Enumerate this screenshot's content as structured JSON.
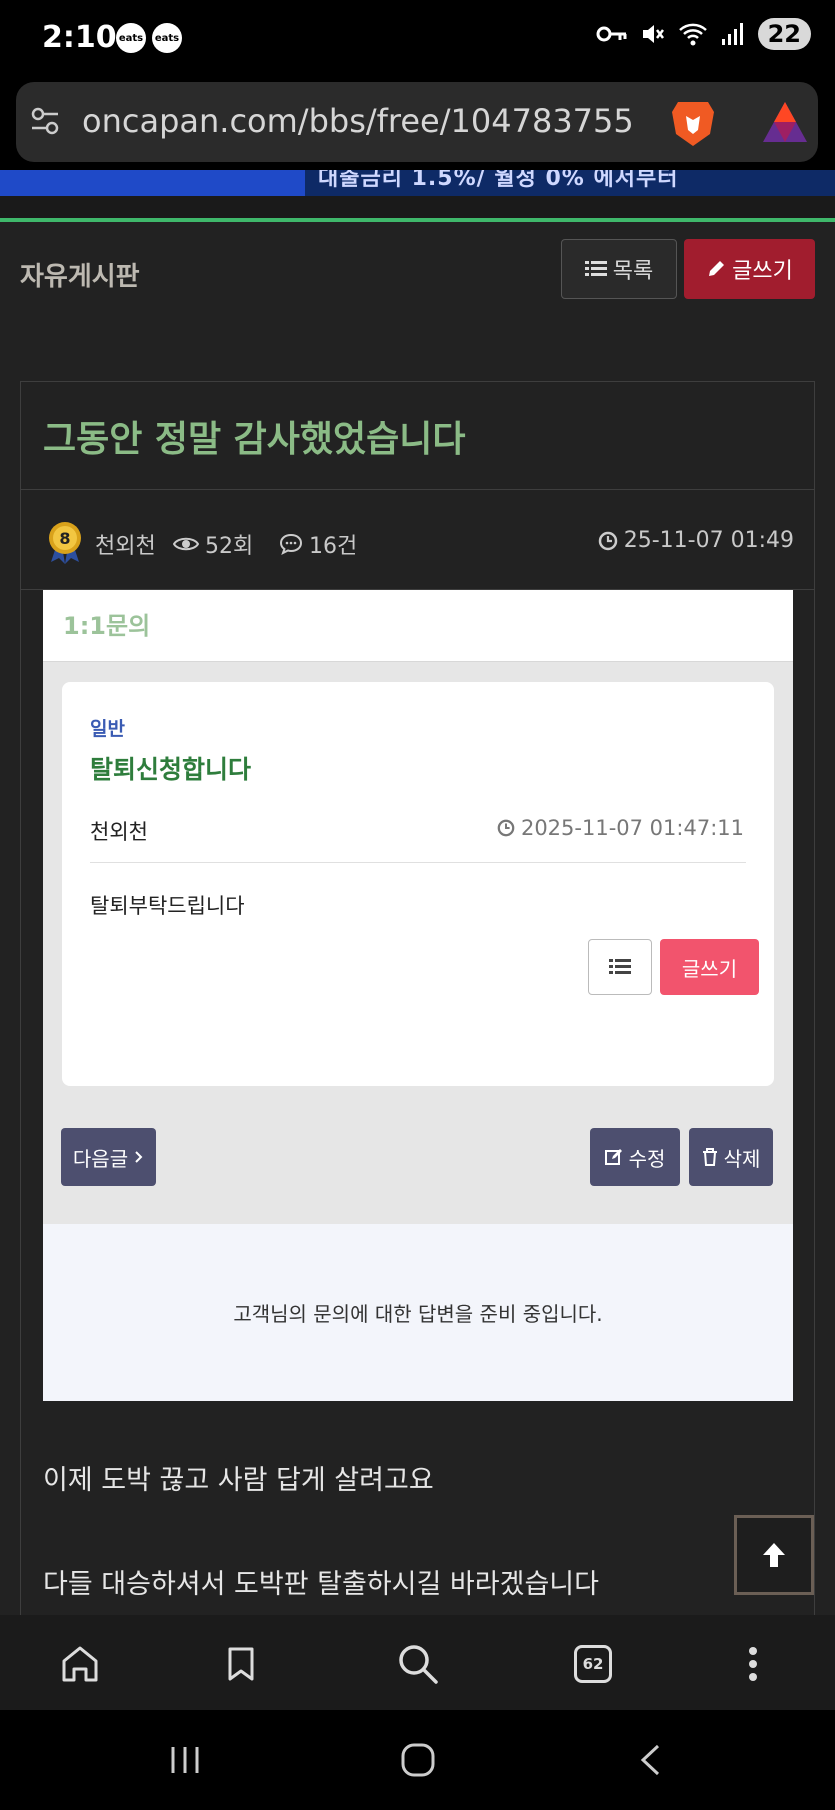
{
  "status": {
    "time": "2:10",
    "notif1": "eats",
    "notif2": "eats",
    "battery": "22"
  },
  "browser": {
    "url": "oncapan.com/bbs/free/104783755",
    "tab_count": "62"
  },
  "banner": {
    "text": "대출금리 1.5%/ 월정 0% 에서부터"
  },
  "board": {
    "title": "자유게시판",
    "list_label": "목록",
    "write_label": "글쓰기"
  },
  "post": {
    "title": "그동안 정말 감사했었습니다",
    "author": "천외천",
    "level": "8",
    "views": "52회",
    "comments": "16건",
    "date": "25-11-07 01:49",
    "lines": [
      "이제 도박 끊고 사람 답게 살려고요",
      "다들 대승하셔서 도박판 탈출하시길 바라겠습니다"
    ]
  },
  "inquiry": {
    "header": "1:1문의",
    "category": "일반",
    "title": "탈퇴신청합니다",
    "author": "천외천",
    "date": "2025-11-07 01:47:11",
    "body": "탈퇴부탁드립니다",
    "write_label": "글쓰기",
    "next_label": "다음글",
    "edit_label": "수정",
    "delete_label": "삭제",
    "reply_text": "고객님의 문의에 대한 답변을 준비 중입니다."
  },
  "colors": {
    "post_title": "#8bbb86",
    "write_button": "#a11d2e",
    "accent_line": "#3fb86b",
    "inquiry_write": "#f2546d",
    "inquiry_nav": "#4d4f6f"
  }
}
